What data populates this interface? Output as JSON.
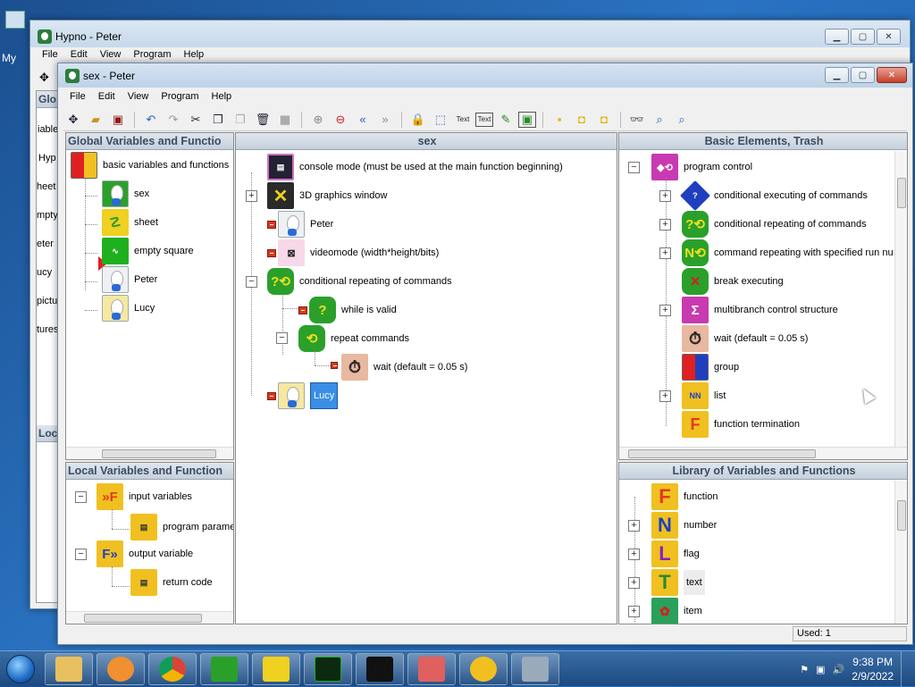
{
  "desktop": {
    "partial_icon_label": "My"
  },
  "back_window": {
    "title": "Hypno - Peter",
    "menu": [
      "File",
      "Edit",
      "View",
      "Program",
      "Help"
    ],
    "peek_labels": [
      "Glo",
      "iable",
      "Hyp",
      "heet",
      "mpty",
      "eter",
      "ucy",
      "pictu",
      "tures",
      "Loc"
    ]
  },
  "front_window": {
    "title": "sex - Peter",
    "menu": [
      "File",
      "Edit",
      "View",
      "Program",
      "Help"
    ],
    "toolbar_icons": [
      "tree-icon",
      "open-folder-icon",
      "save-icon",
      "sep",
      "undo-icon",
      "redo-icon",
      "cut-icon",
      "copy-icon",
      "paste-icon",
      "delete-icon",
      "grid-icon",
      "sep",
      "zoom-in-icon",
      "zoom-out-icon",
      "back-icon",
      "forward-icon",
      "sep",
      "lock-icon",
      "select-icon",
      "text-label-icon",
      "text-box-icon",
      "edit-icon",
      "window-icon",
      "sep",
      "bell1-icon",
      "bell2-icon",
      "bell3-icon",
      "sep",
      "binoculars-icon",
      "find-icon",
      "find-next-icon"
    ],
    "toolbar_glyphs": {
      "text_label": "Text",
      "text_box": "Text"
    },
    "global_pane": {
      "title": "Global Variables and Functio",
      "items": [
        {
          "label": "basic variables and functions",
          "icon": "grid-icon"
        },
        {
          "label": "sex",
          "icon": "bunny-icon"
        },
        {
          "label": "sheet",
          "icon": "sheet-icon"
        },
        {
          "label": "empty square",
          "icon": "empty-square-icon"
        },
        {
          "label": "Peter",
          "icon": "bunny-icon"
        },
        {
          "label": "Lucy",
          "icon": "bunny-icon"
        }
      ]
    },
    "local_pane": {
      "title": "Local Variables and Function",
      "items": [
        {
          "label": "input variables",
          "icon": "input-f-icon"
        },
        {
          "label": "program parame",
          "icon": "param-icon"
        },
        {
          "label": "output variable",
          "icon": "output-f-icon"
        },
        {
          "label": "return code",
          "icon": "return-code-icon"
        }
      ]
    },
    "center_pane": {
      "title": "sex",
      "items": [
        {
          "label": "console mode (must be used at the main function beginning)",
          "icon": "console-icon"
        },
        {
          "label": "3D graphics window",
          "icon": "x-icon"
        },
        {
          "label": "Peter",
          "icon": "bunny-icon"
        },
        {
          "label": "videomode (width*height/bits)",
          "icon": "videomode-icon"
        },
        {
          "label": "conditional repeating of commands",
          "icon": "repeat-icon"
        },
        {
          "label": "while is valid",
          "icon": "question-icon"
        },
        {
          "label": "repeat commands",
          "icon": "repeat-icon"
        },
        {
          "label": "wait (default = 0.05 s)",
          "icon": "stopwatch-icon"
        },
        {
          "label": "Lucy",
          "icon": "bunny-icon"
        }
      ]
    },
    "basic_pane": {
      "title": "Basic Elements, Trash",
      "items": [
        {
          "label": "program control",
          "icon": "program-control-icon"
        },
        {
          "label": "conditional executing of commands",
          "icon": "diamond-icon"
        },
        {
          "label": "conditional repeating of commands",
          "icon": "repeat-icon"
        },
        {
          "label": "command repeating with specified run nu",
          "icon": "n-repeat-icon"
        },
        {
          "label": "break executing",
          "icon": "break-icon"
        },
        {
          "label": "multibranch control structure",
          "icon": "sigma-icon"
        },
        {
          "label": "wait (default = 0.05 s)",
          "icon": "stopwatch-icon"
        },
        {
          "label": "group",
          "icon": "grid-icon"
        },
        {
          "label": "list",
          "icon": "list-icon"
        },
        {
          "label": "function termination",
          "icon": "function-end-icon"
        }
      ]
    },
    "library_pane": {
      "title": "Library of Variables and Functions",
      "items": [
        {
          "label": "function",
          "letter": "F",
          "color": "#e03a1a"
        },
        {
          "label": "number",
          "letter": "N",
          "color": "#1f3fbf"
        },
        {
          "label": "flag",
          "letter": "L",
          "color": "#8b1fbf"
        },
        {
          "label": "text",
          "letter": "T",
          "color": "#2a8a2a"
        },
        {
          "label": "item",
          "letter": "",
          "color": "#2a9a5a"
        }
      ]
    },
    "status": {
      "used": "Used: 1"
    }
  },
  "taskbar": {
    "apps": [
      "explorer-icon",
      "media-player-icon",
      "chrome-icon",
      "hypno-bunny-icon",
      "x-icon",
      "oscilloscope-icon",
      "terminal-icon",
      "cross-icon",
      "film-icon",
      "network-icon"
    ],
    "time": "9:38 PM",
    "date": "2/9/2022"
  }
}
